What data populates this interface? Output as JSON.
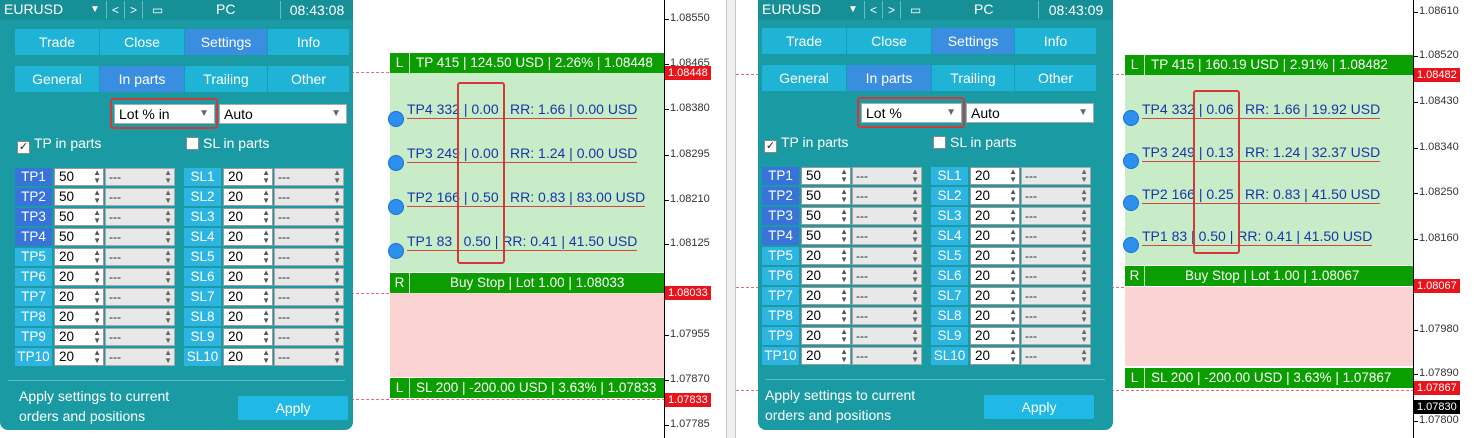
{
  "screens": [
    {
      "panel": {
        "symbol": "EURUSD",
        "nav_prev": "<",
        "nav_next": ">",
        "account": "PC",
        "time": "08:43:08",
        "main_tabs": [
          "Trade",
          "Close",
          "Settings",
          "Info"
        ],
        "main_tab_active": 2,
        "sub_tabs": [
          "General",
          "In parts",
          "Trailing",
          "Other"
        ],
        "sub_tab_active": 1,
        "mode_select": "Lot % in",
        "lot_select": "Auto",
        "tp_in_parts": {
          "label": "TP in parts",
          "checked": true
        },
        "sl_in_parts": {
          "label": "SL in parts",
          "checked": false
        },
        "tp_levels": [
          {
            "label": "TP1",
            "value": "50",
            "opt": "---"
          },
          {
            "label": "TP2",
            "value": "50",
            "opt": "---"
          },
          {
            "label": "TP3",
            "value": "50",
            "opt": "---"
          },
          {
            "label": "TP4",
            "value": "50",
            "opt": "---"
          },
          {
            "label": "TP5",
            "value": "20",
            "opt": "---"
          },
          {
            "label": "TP6",
            "value": "20",
            "opt": "---"
          },
          {
            "label": "TP7",
            "value": "20",
            "opt": "---"
          },
          {
            "label": "TP8",
            "value": "20",
            "opt": "---"
          },
          {
            "label": "TP9",
            "value": "20",
            "opt": "---"
          },
          {
            "label": "TP10",
            "value": "20",
            "opt": "---"
          }
        ],
        "sl_levels": [
          {
            "label": "SL1",
            "value": "20",
            "opt": "---"
          },
          {
            "label": "SL2",
            "value": "20",
            "opt": "---"
          },
          {
            "label": "SL3",
            "value": "20",
            "opt": "---"
          },
          {
            "label": "SL4",
            "value": "20",
            "opt": "---"
          },
          {
            "label": "SL5",
            "value": "20",
            "opt": "---"
          },
          {
            "label": "SL6",
            "value": "20",
            "opt": "---"
          },
          {
            "label": "SL7",
            "value": "20",
            "opt": "---"
          },
          {
            "label": "SL8",
            "value": "20",
            "opt": "---"
          },
          {
            "label": "SL9",
            "value": "20",
            "opt": "---"
          },
          {
            "label": "SL10",
            "value": "20",
            "opt": "---"
          }
        ],
        "footer_text": "Apply settings to current orders and positions",
        "apply_label": "Apply"
      },
      "chart": {
        "tp_bar": {
          "tag": "L",
          "text": "TP 415 | 124.50 USD | 2.26% | 1.08448"
        },
        "tp_rows": [
          {
            "name": "TP4 332",
            "lot": "0.00",
            "rest": "RR: 1.66 | 0.00 USD"
          },
          {
            "name": "TP3 249",
            "lot": "0.00",
            "rest": "RR: 1.24 | 0.00 USD"
          },
          {
            "name": "TP2 166",
            "lot": "0.50",
            "rest": "RR: 0.83 | 83.00 USD"
          },
          {
            "name": "TP1 83",
            "lot": "0.50",
            "rest": "RR: 0.41 | 41.50 USD"
          }
        ],
        "entry_bar": {
          "tag": "R",
          "text": "Buy Stop | Lot 1.00 | 1.08033"
        },
        "sl_bar": {
          "tag": "L",
          "text": "SL 200 | -200.00 USD | 3.63% | 1.07833"
        },
        "ticks": [
          "1.08550",
          "1.08465",
          "1.08380",
          "1.08295",
          "1.08210",
          "1.08125",
          "1.07955",
          "1.07870",
          "1.07785"
        ],
        "price_tp": "1.08448",
        "price_entry": "1.08033",
        "price_sl": "1.07833",
        "colors": {
          "tp_price": "#e8141b",
          "entry_price": "#e8141b",
          "sl_price": "#e8141b"
        }
      }
    },
    {
      "panel": {
        "symbol": "EURUSD",
        "nav_prev": "<",
        "nav_next": ">",
        "account": "PC",
        "time": "08:43:09",
        "main_tabs": [
          "Trade",
          "Close",
          "Settings",
          "Info"
        ],
        "main_tab_active": 2,
        "sub_tabs": [
          "General",
          "In parts",
          "Trailing",
          "Other"
        ],
        "sub_tab_active": 1,
        "mode_select": "Lot %",
        "lot_select": "Auto",
        "tp_in_parts": {
          "label": "TP in parts",
          "checked": true
        },
        "sl_in_parts": {
          "label": "SL in parts",
          "checked": false
        },
        "tp_levels": [
          {
            "label": "TP1",
            "value": "50",
            "opt": "---"
          },
          {
            "label": "TP2",
            "value": "50",
            "opt": "---"
          },
          {
            "label": "TP3",
            "value": "50",
            "opt": "---"
          },
          {
            "label": "TP4",
            "value": "50",
            "opt": "---"
          },
          {
            "label": "TP5",
            "value": "20",
            "opt": "---"
          },
          {
            "label": "TP6",
            "value": "20",
            "opt": "---"
          },
          {
            "label": "TP7",
            "value": "20",
            "opt": "---"
          },
          {
            "label": "TP8",
            "value": "20",
            "opt": "---"
          },
          {
            "label": "TP9",
            "value": "20",
            "opt": "---"
          },
          {
            "label": "TP10",
            "value": "20",
            "opt": "---"
          }
        ],
        "sl_levels": [
          {
            "label": "SL1",
            "value": "20",
            "opt": "---"
          },
          {
            "label": "SL2",
            "value": "20",
            "opt": "---"
          },
          {
            "label": "SL3",
            "value": "20",
            "opt": "---"
          },
          {
            "label": "SL4",
            "value": "20",
            "opt": "---"
          },
          {
            "label": "SL5",
            "value": "20",
            "opt": "---"
          },
          {
            "label": "SL6",
            "value": "20",
            "opt": "---"
          },
          {
            "label": "SL7",
            "value": "20",
            "opt": "---"
          },
          {
            "label": "SL8",
            "value": "20",
            "opt": "---"
          },
          {
            "label": "SL9",
            "value": "20",
            "opt": "---"
          },
          {
            "label": "SL10",
            "value": "20",
            "opt": "---"
          }
        ],
        "footer_text": "Apply settings to current orders and positions",
        "apply_label": "Apply"
      },
      "chart": {
        "tp_bar": {
          "tag": "L",
          "text": "TP 415 | 160.19 USD | 2.91% | 1.08482"
        },
        "tp_rows": [
          {
            "name": "TP4 332",
            "lot": "0.06",
            "rest": "RR: 1.66 | 19.92 USD"
          },
          {
            "name": "TP3 249",
            "lot": "0.13",
            "rest": "RR: 1.24 | 32.37 USD"
          },
          {
            "name": "TP2 166",
            "lot": "0.25",
            "rest": "RR: 0.83 | 41.50 USD"
          },
          {
            "name": "TP1 83",
            "lot": "0.50",
            "rest": "RR: 0.41 | 41.50 USD"
          }
        ],
        "entry_bar": {
          "tag": "R",
          "text": "Buy Stop | Lot 1.00 | 1.08067"
        },
        "sl_bar": {
          "tag": "L",
          "text": "SL 200 | -200.00 USD | 3.63% | 1.07867"
        },
        "ticks": [
          "1.08610",
          "1.08520",
          "1.08430",
          "1.08340",
          "1.08250",
          "1.08160",
          "1.07980",
          "1.07890",
          "1.07800"
        ],
        "price_tp": "1.08482",
        "price_entry": "1.08067",
        "price_sl": "1.07867",
        "price_extra": "1.07830",
        "colors": {
          "tp_price": "#e8141b",
          "entry_price": "#e8141b",
          "sl_price": "#e8141b",
          "extra_price": "#000000"
        }
      }
    }
  ]
}
